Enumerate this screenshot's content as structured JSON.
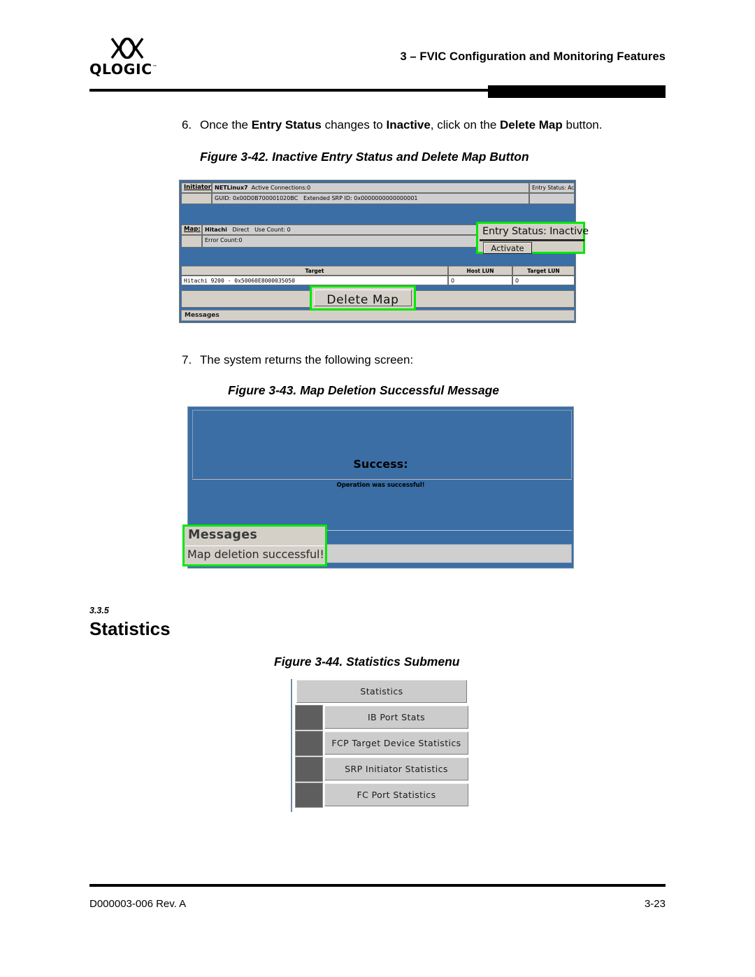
{
  "header": {
    "logo_word": "QLOGIC",
    "logo_tm": "™",
    "chapter_title": "3 – FVIC Configuration and Monitoring Features"
  },
  "steps": [
    {
      "number": "6.",
      "parts": [
        {
          "text": "Once the ",
          "bold": false
        },
        {
          "text": "Entry Status",
          "bold": true
        },
        {
          "text": " changes to ",
          "bold": false
        },
        {
          "text": "Inactive",
          "bold": true
        },
        {
          "text": ", click on the ",
          "bold": false
        },
        {
          "text": "Delete Map",
          "bold": true
        },
        {
          "text": " button.",
          "bold": false
        }
      ]
    },
    {
      "number": "7.",
      "parts": [
        {
          "text": "The system returns the following screen:",
          "bold": false
        }
      ]
    }
  ],
  "figures": {
    "fig42": {
      "caption": "Figure 3-42. Inactive Entry Status and Delete Map Button",
      "initiator_label": "Initiator:",
      "initiator_name": "NETLinux7",
      "initiator_connections": "Active Connections:0",
      "initiator_guid": "GUID: 0x00D0B700001020BC",
      "initiator_srp": "Extended SRP ID: 0x0000000000000001",
      "initiator_entry_status": "Entry Status: Active",
      "map_label": "Map:",
      "map_vendor": "Hitachi",
      "map_mode": "Direct",
      "map_use_count": "Use Count: 0",
      "map_error_count": "Error Count:0",
      "table_headers": {
        "target": "Target",
        "host_lun": "Host LUN",
        "target_lun": "Target LUN"
      },
      "table_row": {
        "target": "Hitachi 9200 - 0x50060E8000035050",
        "host_lun": "0",
        "target_lun": "0"
      },
      "callout_entry_status": "Entry Status: Inactive",
      "activate_button": "Activate",
      "delete_map_button": "Delete Map",
      "messages_bar": "Messages",
      "highlight_color": "#00e800"
    },
    "fig43": {
      "caption": "Figure 3-43. Map Deletion Successful Message",
      "success_title": "Success:",
      "success_text": "Operation was successful!",
      "messages_title": "Messages",
      "messages_text": "Map deletion successful!",
      "highlight_color": "#00e800"
    },
    "fig44": {
      "caption": "Figure 3-44. Statistics Submenu",
      "header_item": "Statistics",
      "items": [
        "IB Port Stats",
        "FCP Target Device Statistics",
        "SRP Initiator Statistics",
        "FC Port Statistics"
      ]
    }
  },
  "section": {
    "number": "3.3.5",
    "title": "Statistics"
  },
  "footer": {
    "document_id": "D000003-006 Rev. A",
    "page_number": "3-23"
  }
}
